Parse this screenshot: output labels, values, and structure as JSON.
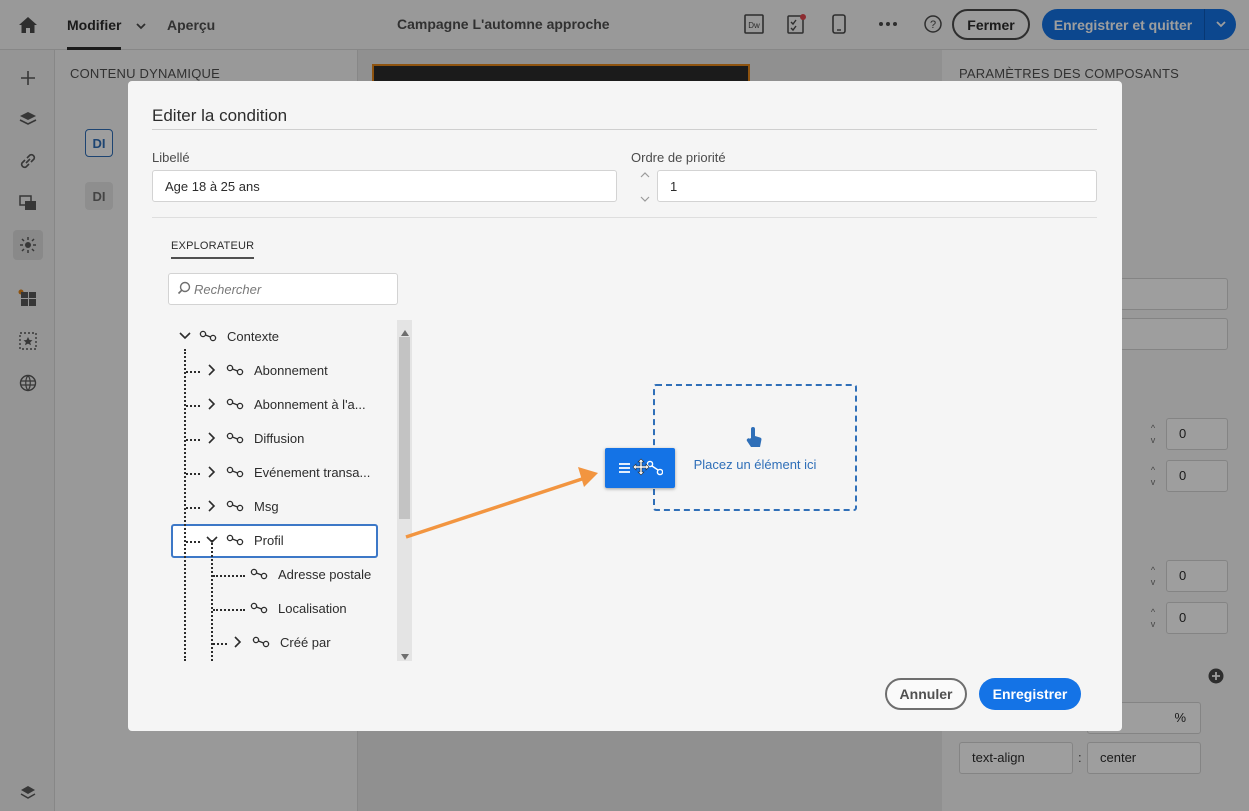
{
  "topbar": {
    "tab_modifier": "Modifier",
    "tab_apercu": "Aperçu",
    "campaign_title": "Campagne L'automne approche",
    "close_label": "Fermer",
    "save_quit_label": "Enregistrer et quitter"
  },
  "left_panel": {
    "title": "CONTENU DYNAMIQUE",
    "chip1": "DI",
    "chip2": "DI"
  },
  "right_panel": {
    "title": "PARAMÈTRES DES COMPOSANTS",
    "value_1": "0",
    "value_2": "0",
    "value_3": "0",
    "value_4": "0",
    "percent": "%",
    "css_property": "text-align",
    "css_separator": ":",
    "css_value": "center"
  },
  "modal": {
    "title": "Editer la condition",
    "label_field_label": "Libellé",
    "label_field_value": "Age 18 à 25 ans",
    "priority_label": "Ordre de priorité",
    "priority_value": "1",
    "explorer_tab": "EXPLORATEUR",
    "search_placeholder": "Rechercher",
    "tree": [
      {
        "label": "Contexte"
      },
      {
        "label": "Abonnement"
      },
      {
        "label": "Abonnement à l'a..."
      },
      {
        "label": "Diffusion"
      },
      {
        "label": "Evénement transa..."
      },
      {
        "label": "Msg"
      },
      {
        "label": "Profil"
      },
      {
        "label": "Adresse postale"
      },
      {
        "label": "Localisation"
      },
      {
        "label": "Créé par"
      }
    ],
    "drop_text": "Placez un élément ici",
    "cancel_label": "Annuler",
    "save_label": "Enregistrer"
  },
  "colors": {
    "accent": "#1473e6",
    "drop_zone": "#2f6fb8",
    "drag_arrow": "#f29540"
  },
  "icons": [
    "home-icon",
    "chevron-down-icon",
    "dreamweaver-icon",
    "checklist-icon",
    "mobile-icon",
    "more-icon",
    "help-icon",
    "search-icon",
    "link-icon",
    "touch-icon",
    "move-cursor-icon"
  ]
}
